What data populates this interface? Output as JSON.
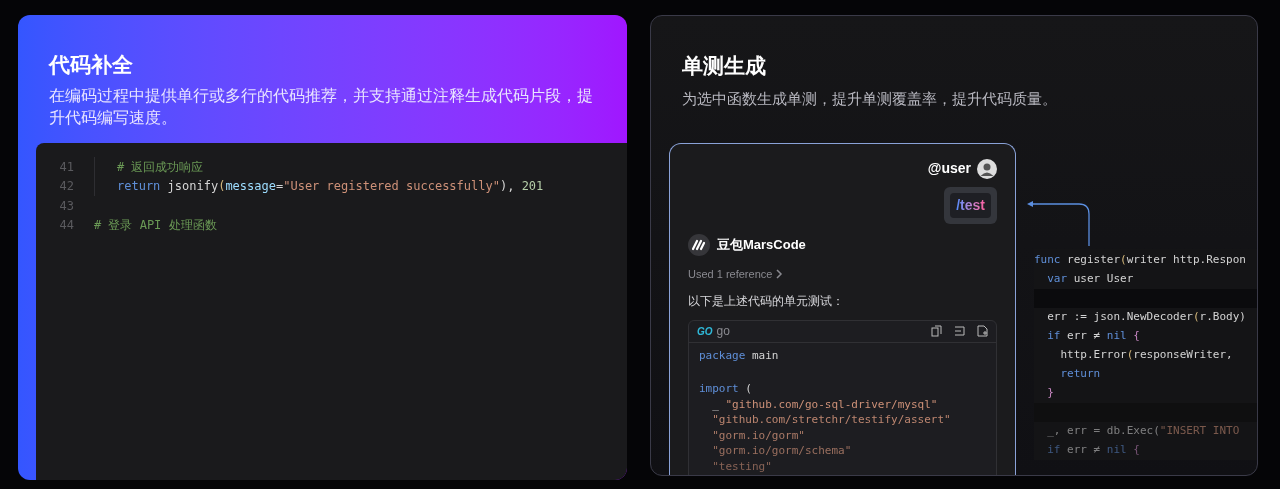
{
  "left_card": {
    "title": "代码补全",
    "description": "在编码过程中提供单行或多行的代码推荐，并支持通过注释生成代码片段，提升代码编写速度。",
    "editor": {
      "lines": [
        {
          "number": "41",
          "indented": true,
          "tokens": [
            {
              "text": "# 返回成功响应",
              "kind": "comment"
            }
          ]
        },
        {
          "number": "42",
          "indented": true,
          "tokens": [
            {
              "text": "return",
              "kind": "keyword"
            },
            {
              "text": " jsonify",
              "kind": "plain"
            },
            {
              "text": "(",
              "kind": "paren"
            },
            {
              "text": "message",
              "kind": "param"
            },
            {
              "text": "=",
              "kind": "plain"
            },
            {
              "text": "\"User registered successfully\"",
              "kind": "string"
            },
            {
              "text": "), ",
              "kind": "plain"
            },
            {
              "text": "201",
              "kind": "number"
            }
          ]
        },
        {
          "number": "43",
          "indented": false
        },
        {
          "number": "44",
          "indented": false,
          "tokens": [
            {
              "text": "# 登录 API 处理函数",
              "kind": "comment"
            }
          ]
        }
      ]
    }
  },
  "right_card": {
    "title": "单测生成",
    "description": "为选中函数生成单测，提升单测覆盖率，提升代码质量。",
    "chat": {
      "user": "@user",
      "command": "/test",
      "assistant": "豆包MarsCode",
      "references": "Used 1 reference",
      "message": "以下是上述代码的单元测试：",
      "code_block": {
        "logo": "GO",
        "language": "go",
        "lines": [
          {
            "tokens": [
              {
                "text": "package",
                "kind": "keyword"
              },
              {
                "text": " main",
                "kind": "plain"
              }
            ]
          },
          {
            "kind": "blank"
          },
          {
            "tokens": [
              {
                "text": "import",
                "kind": "keyword"
              },
              {
                "text": " (",
                "kind": "plain"
              }
            ]
          },
          {
            "tokens": [
              {
                "text": "  _ ",
                "kind": "plain"
              },
              {
                "text": "\"github.com/go-sql-driver/mysql\"",
                "kind": "string"
              }
            ]
          },
          {
            "tokens": [
              {
                "text": "  \"github.com/stretchr/testify/assert\"",
                "kind": "string"
              }
            ]
          },
          {
            "tokens": [
              {
                "text": "  \"gorm.io/gorm\"",
                "kind": "string"
              }
            ]
          },
          {
            "tokens": [
              {
                "text": "  \"gorm.io/gorm/schema\"",
                "kind": "string"
              }
            ]
          },
          {
            "tokens": [
              {
                "text": "  \"testing\"",
                "kind": "string"
              }
            ]
          }
        ]
      }
    },
    "snippet": {
      "lines": [
        {
          "tokens": [
            {
              "text": "func",
              "kind": "keyword"
            },
            {
              "text": " register",
              "kind": "plain"
            },
            {
              "text": "(",
              "kind": "paren"
            },
            {
              "text": "writer http.Respon",
              "kind": "plain"
            }
          ]
        },
        {
          "tokens": [
            {
              "text": "  var",
              "kind": "keyword"
            },
            {
              "text": " user User",
              "kind": "plain"
            }
          ]
        },
        {
          "kind": "blank"
        },
        {
          "tokens": [
            {
              "text": "  err := json.NewDecoder",
              "kind": "plain"
            },
            {
              "text": "(",
              "kind": "paren"
            },
            {
              "text": "r.Body)",
              "kind": "plain"
            }
          ]
        },
        {
          "tokens": [
            {
              "text": "  if",
              "kind": "keyword"
            },
            {
              "text": " err ≠ ",
              "kind": "plain"
            },
            {
              "text": "nil",
              "kind": "keyword"
            },
            {
              "text": " {",
              "kind": "brace"
            }
          ]
        },
        {
          "tokens": [
            {
              "text": "    http.Error",
              "kind": "plain"
            },
            {
              "text": "(",
              "kind": "paren"
            },
            {
              "text": "responseWriter,",
              "kind": "plain"
            }
          ]
        },
        {
          "tokens": [
            {
              "text": "    return",
              "kind": "keyword"
            }
          ]
        },
        {
          "tokens": [
            {
              "text": "  }",
              "kind": "brace"
            }
          ]
        },
        {
          "kind": "blank"
        },
        {
          "tokens": [
            {
              "text": "  _, err = db.Exec(",
              "kind": "plain"
            },
            {
              "text": "\"INSERT INTO",
              "kind": "string"
            }
          ]
        },
        {
          "tokens": [
            {
              "text": "  if",
              "kind": "keyword"
            },
            {
              "text": " err ≠ ",
              "kind": "plain"
            },
            {
              "text": "nil",
              "kind": "keyword"
            },
            {
              "text": " {",
              "kind": "brace"
            }
          ]
        }
      ]
    }
  }
}
